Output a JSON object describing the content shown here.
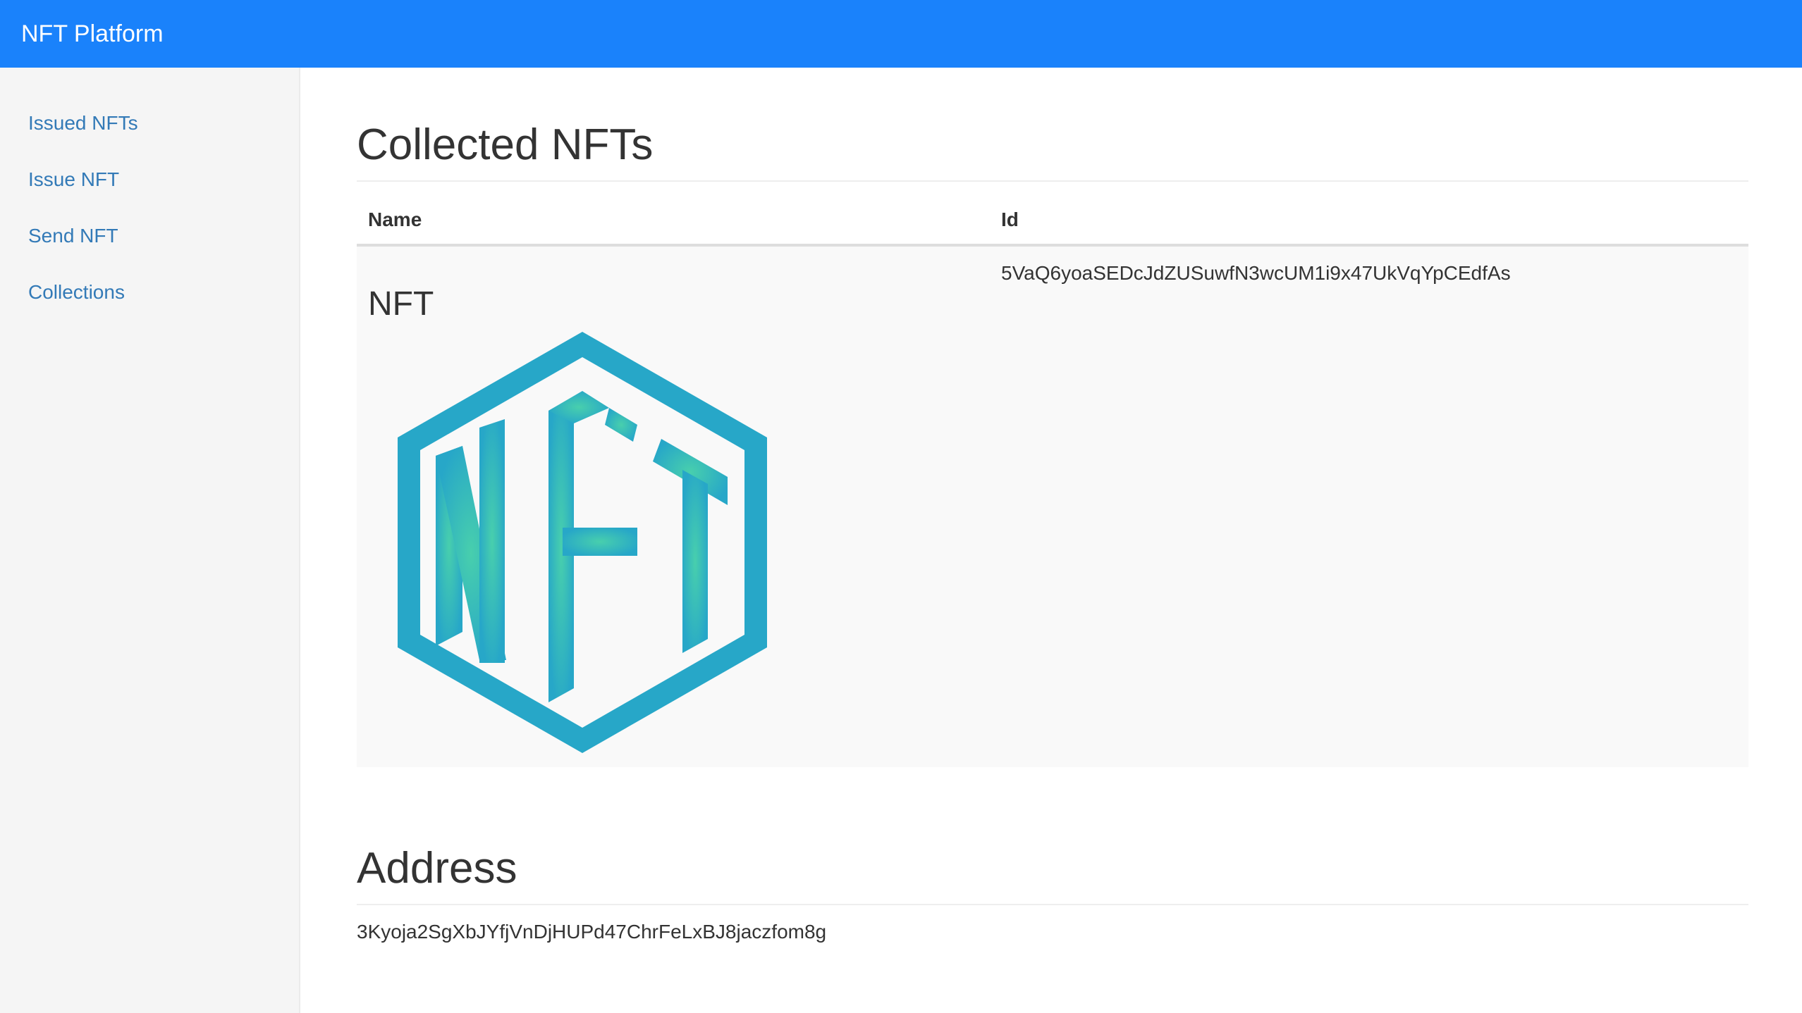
{
  "navbar": {
    "brand": "NFT Platform"
  },
  "sidebar": {
    "items": [
      {
        "label": "Issued NFTs"
      },
      {
        "label": "Issue NFT"
      },
      {
        "label": "Send NFT"
      },
      {
        "label": "Collections"
      }
    ]
  },
  "collected": {
    "title": "Collected NFTs",
    "columns": {
      "name": "Name",
      "id": "Id"
    },
    "rows": [
      {
        "name": "NFT",
        "id": "5VaQ6yoaSEDcJdZUSuwfN3wcUM1i9x47UkVqYpCEdfAs",
        "image_icon": "nft-hexagon-logo-icon"
      }
    ]
  },
  "address": {
    "title": "Address",
    "value": "3Kyoja2SgXbJYfjVnDjHUPd47ChrFeLxBJ8jaczfom8g"
  },
  "colors": {
    "navbar": "#1a82fb",
    "link": "#337ab7",
    "logo_blue": "#27a7c8",
    "logo_green": "#48cfad"
  }
}
